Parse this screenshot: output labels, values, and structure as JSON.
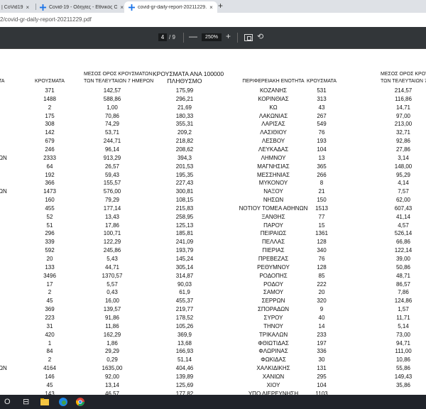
{
  "browser": {
    "tabs": [
      {
        "title": "| CoVid19",
        "active": false
      },
      {
        "title": "Covid-19 - Οδηγίες - Εθνικός Ορ",
        "active": false
      },
      {
        "title": "covid-gr-daily-report-20211229.",
        "active": true
      }
    ],
    "new_tab_label": "+",
    "close_glyph": "×",
    "address": "2/covid-gr-daily-report-20211229.pdf"
  },
  "pdf_toolbar": {
    "page_current": "4",
    "page_total": "/ 9",
    "zoom": "250%",
    "zoom_out": "—",
    "zoom_in": "+",
    "rotate_glyph": "⟲"
  },
  "table": {
    "headers": {
      "left_region": "ΤΑ",
      "left_cases": "ΚΡΟΥΣΜΑΤΑ",
      "left_avg_1": "ΜΕΣΟΣ ΟΡΟΣ ΚΡΟΥΣΜΑΤΩΝ",
      "left_avg_2": "ΤΩΝ ΤΕΛΕΥΤΑΙΩΝ 7 ΗΜΕΡΩΝ",
      "pop_1": "ΚΡΟΥΣΜΑΤΑ ΑΝΑ 100000",
      "pop_2": "ΠΛΗΘΥΣΜΟ",
      "region": "ΠΕΡΙΦΕΡΕΙΑΚΗ ΕΝΟΤΗΤΑ",
      "right_cases": "ΚΡΟΥΣΜΑΤΑ",
      "right_avg_1": "ΜΕΣΟΣ ΟΡΟΣ ΚΡΟΥΣ",
      "right_avg_2": "ΤΩΝ ΤΕΛΕΥΤΑΙΩΝ 7 Η"
    },
    "rows": [
      {
        "lreg": "",
        "lcases": "371",
        "lavg": "142,57",
        "pop": "175,99",
        "reg": "ΚΟΖΑΝΗΣ",
        "rcases": "531",
        "ravg": "214,57"
      },
      {
        "lreg": "",
        "lcases": "1488",
        "lavg": "588,86",
        "pop": "296,21",
        "reg": "ΚΟΡΙΝΘΙΑΣ",
        "rcases": "313",
        "ravg": "116,86"
      },
      {
        "lreg": "",
        "lcases": "2",
        "lavg": "1,00",
        "pop": "21,69",
        "reg": "ΚΩ",
        "rcases": "43",
        "ravg": "14,71"
      },
      {
        "lreg": "",
        "lcases": "175",
        "lavg": "70,86",
        "pop": "180,33",
        "reg": "ΛΑΚΩΝΙΑΣ",
        "rcases": "267",
        "ravg": "97,00"
      },
      {
        "lreg": "",
        "lcases": "308",
        "lavg": "74,29",
        "pop": "355,31",
        "reg": "ΛΑΡΙΣΑΣ",
        "rcases": "549",
        "ravg": "213,00"
      },
      {
        "lreg": "",
        "lcases": "142",
        "lavg": "53,71",
        "pop": "209,2",
        "reg": "ΛΑΣΙΘΙΟΥ",
        "rcases": "76",
        "ravg": "32,71"
      },
      {
        "lreg": "",
        "lcases": "679",
        "lavg": "244,71",
        "pop": "218,82",
        "reg": "ΛΕΣΒΟΥ",
        "rcases": "193",
        "ravg": "92,86"
      },
      {
        "lreg": "",
        "lcases": "246",
        "lavg": "96,14",
        "pop": "208,62",
        "reg": "ΛΕΥΚΑΔΑΣ",
        "rcases": "104",
        "ravg": "27,86"
      },
      {
        "lreg": "ΩΝ",
        "lcases": "2333",
        "lavg": "913,29",
        "pop": "394,3",
        "reg": "ΛΗΜΝΟΥ",
        "rcases": "13",
        "ravg": "3,14"
      },
      {
        "lreg": "",
        "lcases": "64",
        "lavg": "26,57",
        "pop": "201,53",
        "reg": "ΜΑΓΝΗΣΙΑΣ",
        "rcases": "365",
        "ravg": "148,00"
      },
      {
        "lreg": "",
        "lcases": "192",
        "lavg": "59,43",
        "pop": "195,35",
        "reg": "ΜΕΣΣΗΝΙΑΣ",
        "rcases": "266",
        "ravg": "95,29"
      },
      {
        "lreg": "",
        "lcases": "366",
        "lavg": "155,57",
        "pop": "227,43",
        "reg": "ΜΥΚΟΝΟΥ",
        "rcases": "8",
        "ravg": "4,14"
      },
      {
        "lreg": "ΩΝ",
        "lcases": "1473",
        "lavg": "576,00",
        "pop": "300,81",
        "reg": "ΝΑΞΟΥ",
        "rcases": "21",
        "ravg": "7,57"
      },
      {
        "lreg": "",
        "lcases": "160",
        "lavg": "79,29",
        "pop": "108,15",
        "reg": "ΝΗΣΩΝ",
        "rcases": "150",
        "ravg": "62,00"
      },
      {
        "lreg": "",
        "lcases": "455",
        "lavg": "177,14",
        "pop": "215,83",
        "reg": "ΝΟΤΙΟΥ ΤΟΜΕΑ ΑΘΗΝΩΝ",
        "rcases": "1513",
        "ravg": "607,43"
      },
      {
        "lreg": "",
        "lcases": "52",
        "lavg": "13,43",
        "pop": "258,95",
        "reg": "ΞΑΝΘΗΣ",
        "rcases": "77",
        "ravg": "41,14"
      },
      {
        "lreg": "",
        "lcases": "51",
        "lavg": "17,86",
        "pop": "125,13",
        "reg": "ΠΑΡΟΥ",
        "rcases": "15",
        "ravg": "4,57"
      },
      {
        "lreg": "",
        "lcases": "296",
        "lavg": "100,71",
        "pop": "185,81",
        "reg": "ΠΕΙΡΑΙΩΣ",
        "rcases": "1361",
        "ravg": "526,14"
      },
      {
        "lreg": "",
        "lcases": "339",
        "lavg": "122,29",
        "pop": "241,09",
        "reg": "ΠΕΛΛΑΣ",
        "rcases": "128",
        "ravg": "66,86"
      },
      {
        "lreg": "",
        "lcases": "592",
        "lavg": "245,86",
        "pop": "193,79",
        "reg": "ΠΙΕΡΙΑΣ",
        "rcases": "340",
        "ravg": "122,14"
      },
      {
        "lreg": "",
        "lcases": "20",
        "lavg": "5,43",
        "pop": "145,24",
        "reg": "ΠΡΕΒΕΖΑΣ",
        "rcases": "76",
        "ravg": "39,00"
      },
      {
        "lreg": "",
        "lcases": "133",
        "lavg": "44,71",
        "pop": "305,14",
        "reg": "ΡΕΘΥΜΝΟΥ",
        "rcases": "128",
        "ravg": "50,86"
      },
      {
        "lreg": "",
        "lcases": "3496",
        "lavg": "1370,57",
        "pop": "314,87",
        "reg": "ΡΟΔΟΠΗΣ",
        "rcases": "85",
        "ravg": "48,71"
      },
      {
        "lreg": "",
        "lcases": "17",
        "lavg": "5,57",
        "pop": "90,03",
        "reg": "ΡΟΔΟΥ",
        "rcases": "222",
        "ravg": "86,57"
      },
      {
        "lreg": "",
        "lcases": "2",
        "lavg": "0,43",
        "pop": "61,9",
        "reg": "ΣΑΜΟΥ",
        "rcases": "20",
        "ravg": "7,86"
      },
      {
        "lreg": "",
        "lcases": "45",
        "lavg": "16,00",
        "pop": "455,37",
        "reg": "ΣΕΡΡΩΝ",
        "rcases": "320",
        "ravg": "124,86"
      },
      {
        "lreg": "",
        "lcases": "369",
        "lavg": "139,57",
        "pop": "219,77",
        "reg": "ΣΠΟΡΑΔΩΝ",
        "rcases": "9",
        "ravg": "1,57"
      },
      {
        "lreg": "",
        "lcases": "223",
        "lavg": "91,86",
        "pop": "178,52",
        "reg": "ΣΥΡΟΥ",
        "rcases": "40",
        "ravg": "11,71"
      },
      {
        "lreg": "",
        "lcases": "31",
        "lavg": "11,86",
        "pop": "105,26",
        "reg": "ΤΗΝΟΥ",
        "rcases": "14",
        "ravg": "5,14"
      },
      {
        "lreg": "",
        "lcases": "420",
        "lavg": "162,29",
        "pop": "369,9",
        "reg": "ΤΡΙΚΑΛΩΝ",
        "rcases": "233",
        "ravg": "73,00"
      },
      {
        "lreg": "",
        "lcases": "1",
        "lavg": "1,86",
        "pop": "13,68",
        "reg": "ΦΘΙΩΤΙΔΑΣ",
        "rcases": "197",
        "ravg": "94,71"
      },
      {
        "lreg": "",
        "lcases": "84",
        "lavg": "29,29",
        "pop": "166,93",
        "reg": "ΦΛΩΡΙΝΑΣ",
        "rcases": "336",
        "ravg": "111,00"
      },
      {
        "lreg": "",
        "lcases": "2",
        "lavg": "0,29",
        "pop": "51,14",
        "reg": "ΦΩΚΙΔΑΣ",
        "rcases": "30",
        "ravg": "10,86"
      },
      {
        "lreg": "ΩΝ",
        "lcases": "4164",
        "lavg": "1635,00",
        "pop": "404,46",
        "reg": "ΧΑΛΚΙΔΙΚΗΣ",
        "rcases": "131",
        "ravg": "55,86"
      },
      {
        "lreg": "",
        "lcases": "146",
        "lavg": "92,00",
        "pop": "139,89",
        "reg": "ΧΑΝΙΩΝ",
        "rcases": "295",
        "ravg": "149,43"
      },
      {
        "lreg": "",
        "lcases": "45",
        "lavg": "13,14",
        "pop": "125,69",
        "reg": "ΧΙΟΥ",
        "rcases": "104",
        "ravg": "35,86"
      },
      {
        "lreg": "",
        "lcases": "143",
        "lavg": "46,57",
        "pop": "177,82",
        "reg": "ΥΠΟ ΔΙΕΡΕΥΝΗΣΗ",
        "rcases": "1103",
        "ravg": ""
      }
    ]
  },
  "taskbar": {
    "search_glyph": "O",
    "taskview_glyph": "⊟"
  }
}
